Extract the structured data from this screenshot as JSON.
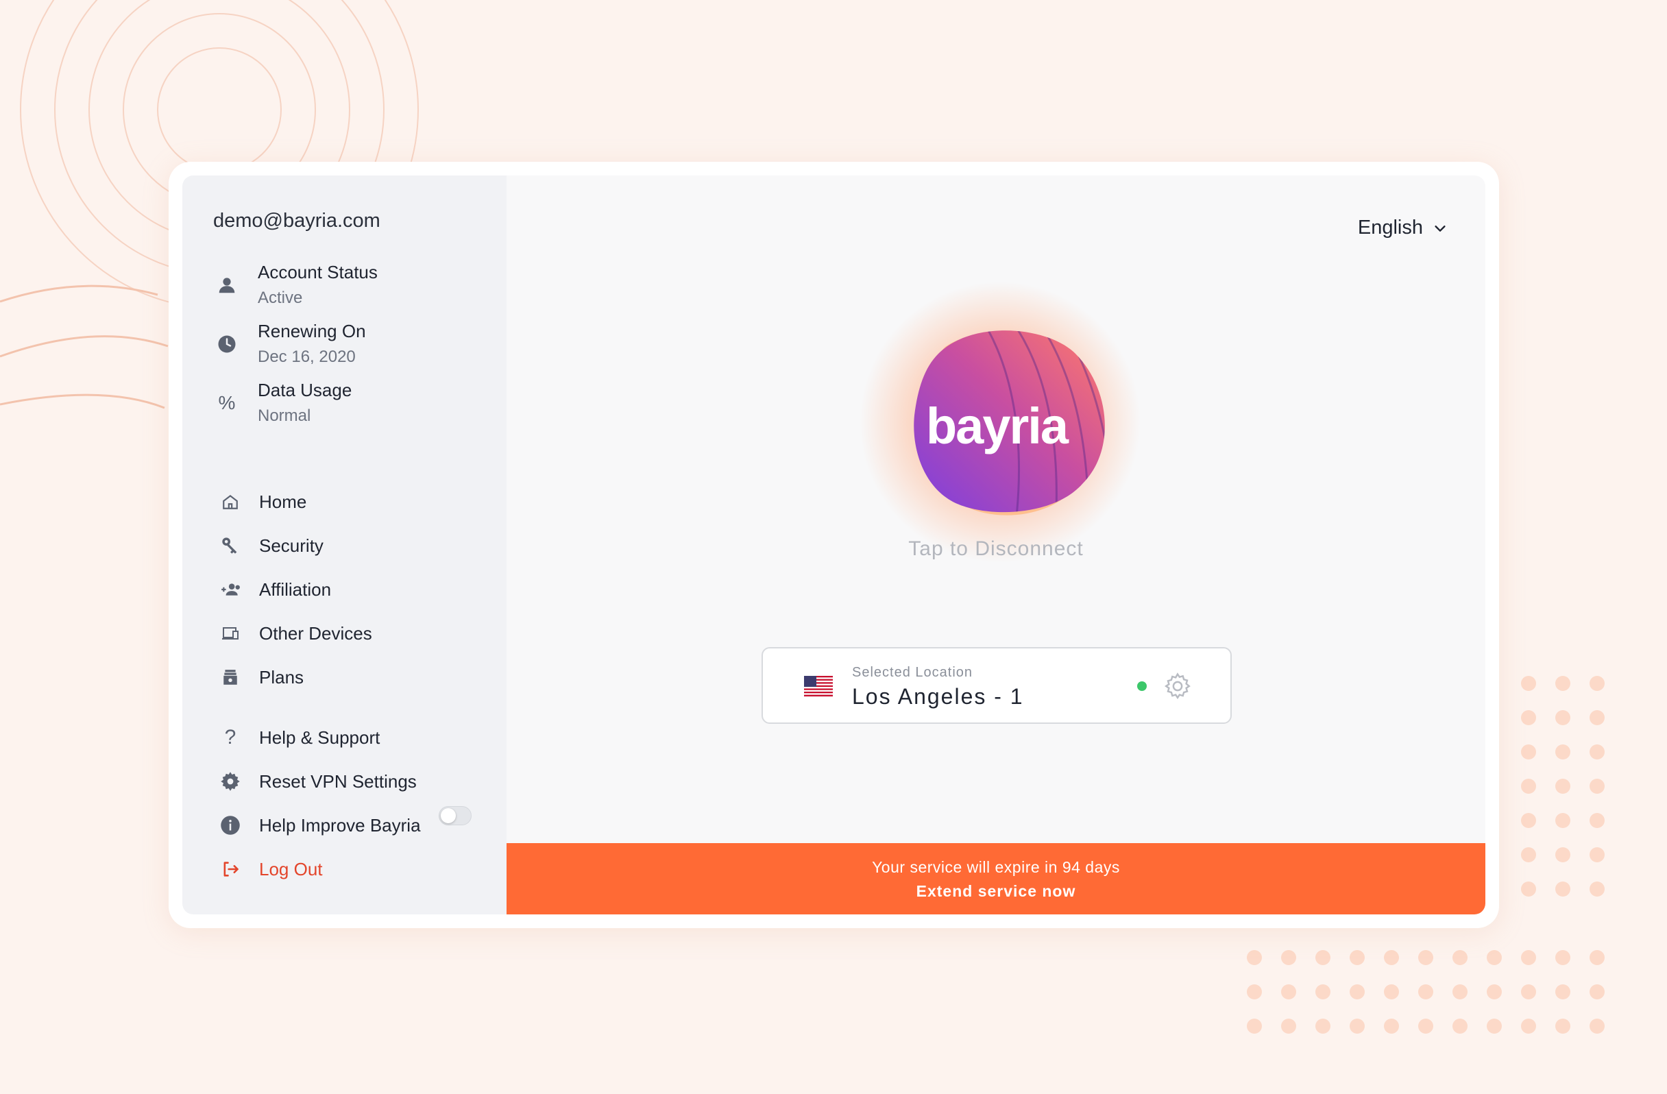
{
  "account": {
    "email": "demo@bayria.com",
    "status_items": [
      {
        "icon": "user-icon",
        "title": "Account Status",
        "value": "Active"
      },
      {
        "icon": "clock-icon",
        "title": "Renewing On",
        "value": "Dec 16, 2020"
      },
      {
        "icon": "percent-icon",
        "title": "Data Usage",
        "value": "Normal"
      }
    ]
  },
  "sidebar": {
    "nav": [
      {
        "icon": "home-icon",
        "label": "Home"
      },
      {
        "icon": "key-icon",
        "label": "Security"
      },
      {
        "icon": "people-icon",
        "label": "Affiliation"
      },
      {
        "icon": "devices-icon",
        "label": "Other Devices"
      },
      {
        "icon": "plans-icon",
        "label": "Plans"
      }
    ],
    "settings": [
      {
        "icon": "question-icon",
        "label": "Help & Support"
      },
      {
        "icon": "gear-icon",
        "label": "Reset VPN Settings"
      },
      {
        "icon": "info-icon",
        "label": "Help Improve Bayria",
        "toggle": false
      }
    ],
    "logout": {
      "icon": "logout-icon",
      "label": "Log Out"
    }
  },
  "header": {
    "language": "English"
  },
  "connection": {
    "brand": "bayria",
    "action_text": "Tap to Disconnect"
  },
  "location": {
    "caption": "Selected Location",
    "name": "Los Angeles - 1",
    "flag": "us-flag-icon",
    "status_color": "#3cc76a"
  },
  "banner": {
    "message": "Your service will expire in 94 days",
    "cta": "Extend service now",
    "color": "#ff6a35"
  },
  "colors": {
    "accent": "#ff6a35",
    "logout": "#e3452b"
  }
}
